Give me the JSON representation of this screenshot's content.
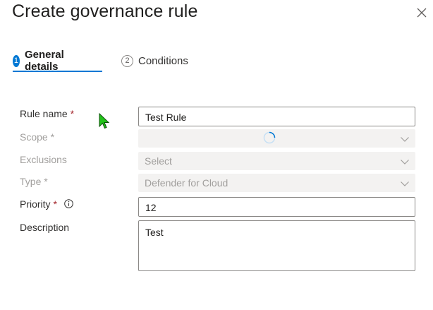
{
  "header": {
    "title": "Create governance rule",
    "close_icon": "close-icon"
  },
  "tabs": [
    {
      "number": "1",
      "label": "General details",
      "active": true
    },
    {
      "number": "2",
      "label": "Conditions",
      "active": false
    }
  ],
  "form": {
    "rule_name": {
      "label": "Rule name",
      "required": "*",
      "value": "Test Rule"
    },
    "scope": {
      "label": "Scope",
      "required": "*",
      "value": "",
      "loading": true
    },
    "exclusions": {
      "label": "Exclusions",
      "placeholder": "Select"
    },
    "type": {
      "label": "Type",
      "required": "*",
      "value": "Defender for Cloud"
    },
    "priority": {
      "label": "Priority",
      "required": "*",
      "value": "12",
      "info_icon": "info-icon"
    },
    "description": {
      "label": "Description",
      "value": "Test"
    }
  },
  "colors": {
    "accent": "#0078d4",
    "required": "#a4262c",
    "disabled_bg": "#f3f2f1",
    "disabled_text": "#a19f9d",
    "cursor": "#22c21a"
  }
}
